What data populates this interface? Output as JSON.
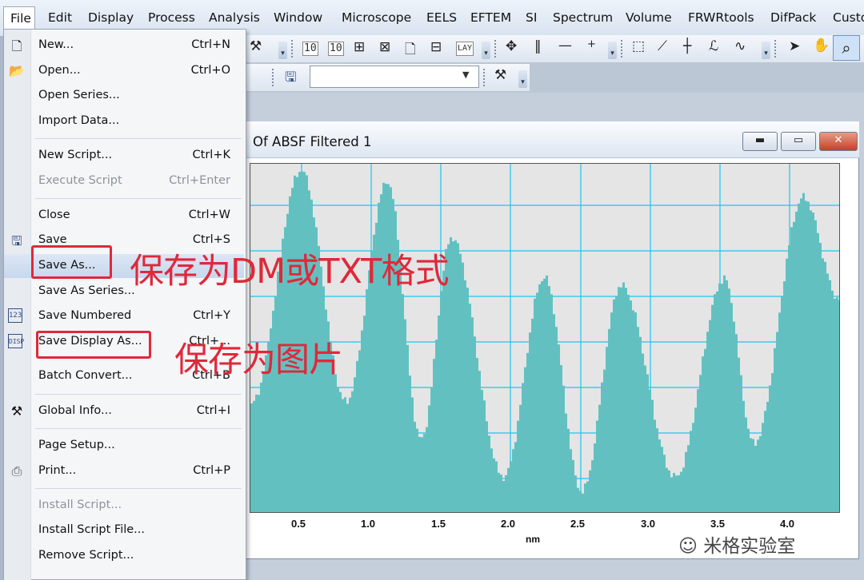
{
  "menubar": {
    "items": [
      "File",
      "Edit",
      "Display",
      "Process",
      "Analysis",
      "Window",
      "Microscope",
      "EELS",
      "EFTEM",
      "SI",
      "Spectrum",
      "Volume",
      "FRWRtools",
      "DifPack",
      "Custo"
    ]
  },
  "toolbar": {
    "icons": [
      "hammer-icon",
      "sum-1-icon",
      "sum-x-icon",
      "plot-add-icon",
      "plot-remove-icon",
      "page-search-icon",
      "layout-icon",
      "lay-icon",
      "move-icon",
      "bar-icon",
      "line-icon",
      "plus-icon",
      "rect-select-icon",
      "line-tool-icon",
      "crosshair-icon",
      "lasso-icon",
      "curve-icon",
      "arrow-pointer-icon",
      "hand-icon",
      "magnifier-icon"
    ],
    "combo_value": ""
  },
  "document": {
    "title": "Of ABSF Filtered 1",
    "x_unit": "nm",
    "x_ticks": [
      "0.5",
      "1.0",
      "1.5",
      "2.0",
      "2.5",
      "3.0",
      "3.5",
      "4.0"
    ]
  },
  "file_menu": {
    "items": [
      {
        "label": "New...",
        "shortcut": "Ctrl+N",
        "icon": "new-doc-icon",
        "enabled": true
      },
      {
        "label": "Open...",
        "shortcut": "Ctrl+O",
        "icon": "open-folder-icon",
        "enabled": true
      },
      {
        "label": "Open Series...",
        "shortcut": "",
        "icon": "",
        "enabled": true
      },
      {
        "label": "Import Data...",
        "shortcut": "",
        "icon": "",
        "enabled": true
      },
      {
        "label": "New Script...",
        "shortcut": "Ctrl+K",
        "icon": "",
        "enabled": true
      },
      {
        "label": "Execute Script",
        "shortcut": "Ctrl+Enter",
        "icon": "",
        "enabled": false
      },
      {
        "label": "Close",
        "shortcut": "Ctrl+W",
        "icon": "",
        "enabled": true
      },
      {
        "label": "Save",
        "shortcut": "Ctrl+S",
        "icon": "floppy-icon",
        "enabled": true
      },
      {
        "label": "Save As...",
        "shortcut": "",
        "icon": "",
        "enabled": true
      },
      {
        "label": "Save As Series...",
        "shortcut": "",
        "icon": "",
        "enabled": true
      },
      {
        "label": "Save Numbered",
        "shortcut": "Ctrl+Y",
        "icon": "numbered-icon",
        "enabled": true
      },
      {
        "label": "Save Display As...",
        "shortcut": "Ctrl+...",
        "icon": "display-icon",
        "enabled": true
      },
      {
        "label": "Batch Convert...",
        "shortcut": "Ctrl+B",
        "icon": "",
        "enabled": true
      },
      {
        "label": "Global Info...",
        "shortcut": "Ctrl+I",
        "icon": "tools-icon",
        "enabled": true
      },
      {
        "label": "Page Setup...",
        "shortcut": "",
        "icon": "",
        "enabled": true
      },
      {
        "label": "Print...",
        "shortcut": "Ctrl+P",
        "icon": "printer-icon",
        "enabled": true
      },
      {
        "label": "Install Script...",
        "shortcut": "",
        "icon": "",
        "enabled": false
      },
      {
        "label": "Install Script File...",
        "shortcut": "",
        "icon": "",
        "enabled": true
      },
      {
        "label": "Remove Script...",
        "shortcut": "",
        "icon": "",
        "enabled": true
      }
    ]
  },
  "annotations": {
    "save_as_note": "保存为DM或TXT格式",
    "save_display_note": "保存为图片"
  },
  "watermark": "米格实验室",
  "colors": {
    "histogram_fill": "#62c1c0",
    "grid": "#19c7ef",
    "annotation_red": "#e0283a"
  }
}
